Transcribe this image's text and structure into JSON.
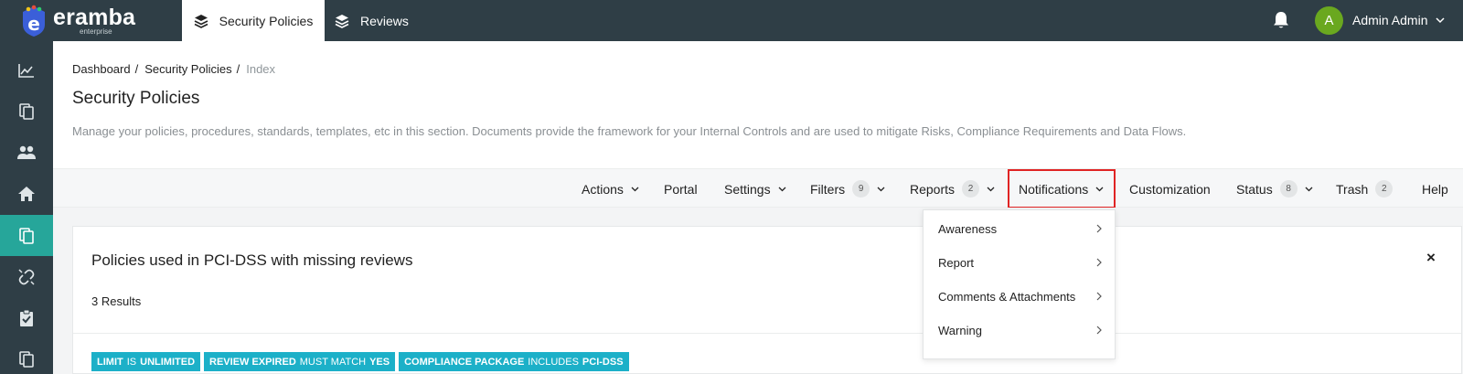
{
  "app": {
    "logo_text": "eramba",
    "logo_subtext": "enterprise"
  },
  "topnav": {
    "tabs": [
      {
        "label": "Security Policies",
        "icon": "layers-icon",
        "active": true
      },
      {
        "label": "Reviews",
        "icon": "layers-icon",
        "active": false
      }
    ],
    "notifications_icon": "bell-icon",
    "user": {
      "initial": "A",
      "name": "Admin Admin",
      "avatar_color": "#6aa81f"
    }
  },
  "sidebar": {
    "items": [
      {
        "icon": "chart-icon",
        "active": false
      },
      {
        "icon": "documents-icon",
        "active": false
      },
      {
        "icon": "users-icon",
        "active": false
      },
      {
        "icon": "home-icon",
        "active": false
      },
      {
        "icon": "documents-icon",
        "active": true
      },
      {
        "icon": "unlink-icon",
        "active": false
      },
      {
        "icon": "clipboard-check-icon",
        "active": false
      },
      {
        "icon": "documents-icon",
        "active": false
      }
    ]
  },
  "breadcrumb": [
    "Dashboard",
    "Security Policies",
    "Index"
  ],
  "page": {
    "title": "Security Policies",
    "description": "Manage your policies, procedures, standards, templates, etc in this section. Documents provide the framework for your Internal Controls and are used to mitigate Risks, Compliance Requirements and Data Flows."
  },
  "toolbar": {
    "actions": "Actions",
    "portal": "Portal",
    "settings": "Settings",
    "filters": "Filters",
    "filters_count": "9",
    "reports": "Reports",
    "reports_count": "2",
    "notifications": "Notifications",
    "customization": "Customization",
    "status": "Status",
    "status_count": "8",
    "trash": "Trash",
    "trash_count": "2",
    "help": "Help"
  },
  "notifications_menu": {
    "items": [
      "Awareness",
      "Report",
      "Comments & Attachments",
      "Warning"
    ]
  },
  "filter_card": {
    "title": "Policies used in PCI-DSS with missing reviews",
    "results": "3 Results",
    "close": "×",
    "chips": [
      {
        "field": "LIMIT",
        "op": "IS",
        "value": "UNLIMITED"
      },
      {
        "field": "REVIEW EXPIRED",
        "op": "MUST MATCH",
        "value": "YES"
      },
      {
        "field": "COMPLIANCE PACKAGE",
        "op": "INCLUDES",
        "value": "PCI-DSS"
      }
    ]
  },
  "colors": {
    "topbar": "#2f3e46",
    "accent": "#26a69a",
    "chip": "#1cb0c8",
    "highlight": "#e02424"
  }
}
